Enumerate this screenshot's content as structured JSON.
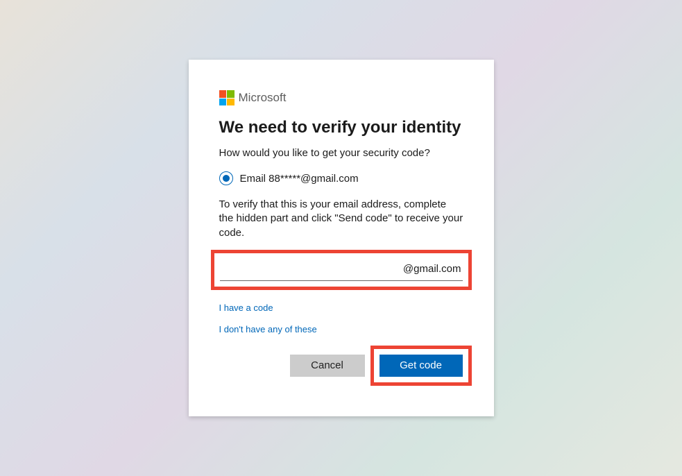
{
  "brand": {
    "name": "Microsoft"
  },
  "title": "We need to verify your identity",
  "subtitle": "How would you like to get your security code?",
  "radio": {
    "label": "Email 88*****@gmail.com"
  },
  "instruction": "To verify that this is your email address, complete the hidden part and click \"Send code\" to receive your code.",
  "input": {
    "value": "",
    "suffix": "@gmail.com"
  },
  "links": {
    "have_code": "I have a code",
    "none": "I don't have any of these"
  },
  "buttons": {
    "cancel": "Cancel",
    "get_code": "Get code"
  }
}
